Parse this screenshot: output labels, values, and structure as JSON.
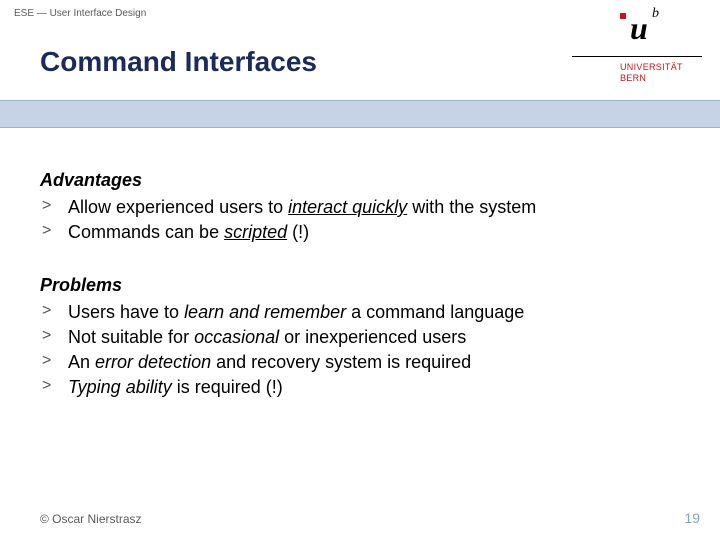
{
  "header": {
    "course": "ESE — User Interface Design",
    "title": "Command Interfaces"
  },
  "logo": {
    "glyph": "u",
    "sup": "b",
    "line1": "UNIVERSITÄT",
    "line2": "BERN"
  },
  "advantages": {
    "heading": "Advantages",
    "items": {
      "a0": {
        "pre": "Allow experienced users to ",
        "em": "interact quickly",
        "post": " with the system"
      },
      "a1": {
        "pre": "Commands can be ",
        "em": "scripted",
        "post": " (!)"
      }
    }
  },
  "problems": {
    "heading": "Problems",
    "items": {
      "p0": {
        "pre": "Users have to ",
        "em": "learn and remember",
        "post": " a command language"
      },
      "p1": {
        "pre": "Not suitable for ",
        "em": "occasional",
        "post": " or inexperienced users"
      },
      "p2": {
        "pre": "An ",
        "em": "error detection",
        "post": " and recovery system is required"
      },
      "p3": {
        "em": "Typing ability",
        "post": " is required (!)"
      }
    }
  },
  "footer": {
    "copyright": "© Oscar Nierstrasz",
    "page": "19"
  }
}
